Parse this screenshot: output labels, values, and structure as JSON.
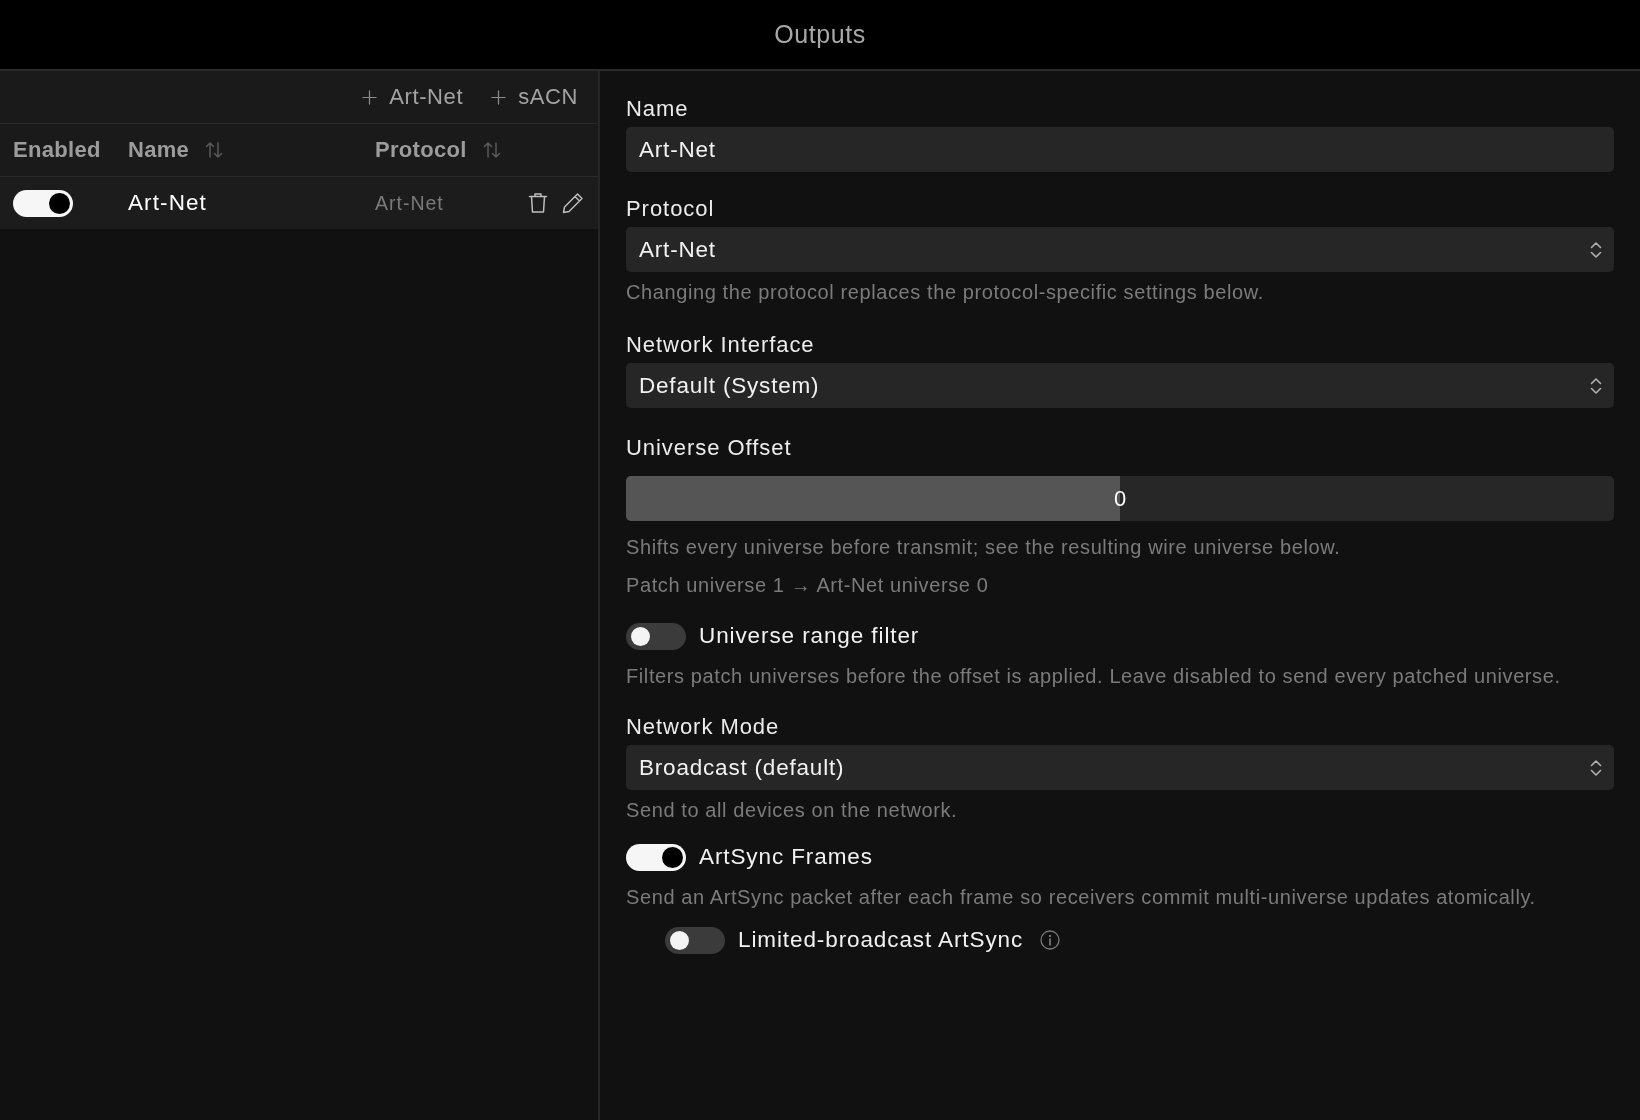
{
  "window": {
    "title": "Outputs"
  },
  "outputs_list": {
    "toolbar": [
      {
        "label": "Art-Net"
      },
      {
        "label": "sACN"
      }
    ],
    "columns": [
      {
        "label": "Enabled",
        "sortable": false
      },
      {
        "label": "Name",
        "sortable": true
      },
      {
        "label": "Protocol",
        "sortable": true
      }
    ],
    "rows": [
      {
        "enabled": true,
        "name": "Art-Net",
        "protocol": "Art-Net"
      }
    ]
  },
  "form": {
    "fields": [
      {
        "kind": "text",
        "label": "Name",
        "value": "Art-Net"
      },
      {
        "kind": "select",
        "label": "Protocol",
        "value": "Art-Net",
        "help": "Changing the protocol replaces the protocol-specific settings below."
      },
      {
        "kind": "select",
        "label": "Network Interface",
        "value": "Default (System)"
      },
      {
        "kind": "slider",
        "label": "Universe Offset",
        "value": "0",
        "level": 0.5,
        "help": "Shifts every universe before transmit; see the resulting wire universe below."
      },
      {
        "kind": "note",
        "text": "Patch universe 1 → Art-Net universe 0"
      },
      {
        "kind": "toggle",
        "label": "Universe range filter",
        "on": false,
        "help": "Filters patch universes before the offset is applied. Leave disabled to send every patched universe."
      },
      {
        "kind": "select",
        "label": "Network Mode",
        "value": "Broadcast (default)",
        "help": "Send to all devices on the network."
      },
      {
        "kind": "toggle",
        "label": "ArtSync Frames",
        "on": true,
        "help": "Send an ArtSync packet after each frame so receivers commit multi-universe updates atomically.",
        "children": [
          {
            "kind": "toggle",
            "label": "Limited-broadcast ArtSync",
            "on": false,
            "info": true
          }
        ]
      }
    ]
  }
}
